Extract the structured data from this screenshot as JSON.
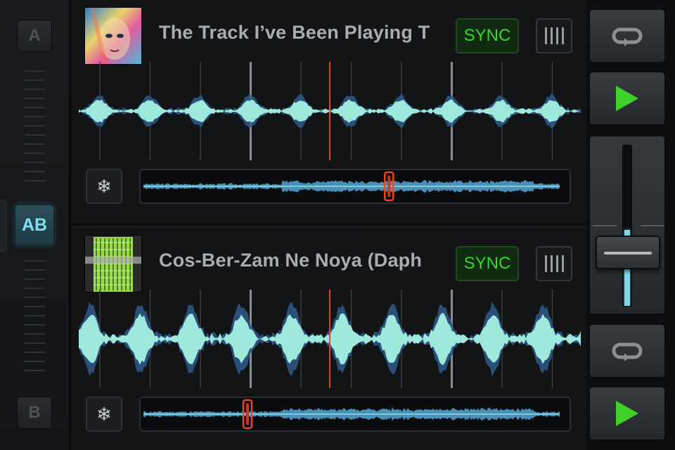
{
  "crossfader": {
    "deck_a_label": "A",
    "deck_b_label": "B",
    "ab_label": "AB"
  },
  "deck_a": {
    "title": "The Track I’ve Been Playing T",
    "sync_label": "SYNC",
    "beatgrid_icon": "beatgrid-icon",
    "freeze_icon": "snowflake-icon",
    "playhead_fraction": 0.59
  },
  "deck_b": {
    "title": "Cos-Ber-Zam Ne Noya (Daph",
    "sync_label": "SYNC",
    "beatgrid_icon": "beatgrid-icon",
    "freeze_icon": "snowflake-icon",
    "playhead_fraction": 0.25
  },
  "controls": {
    "loop_icon": "loop-icon",
    "play_icon": "play-icon",
    "channel_fader_level": 0.3
  },
  "colors": {
    "accent_cyan": "#7fe3ee",
    "sync_green": "#38d72d",
    "playhead_red": "#e8452f",
    "play_green": "#3dd12a"
  }
}
